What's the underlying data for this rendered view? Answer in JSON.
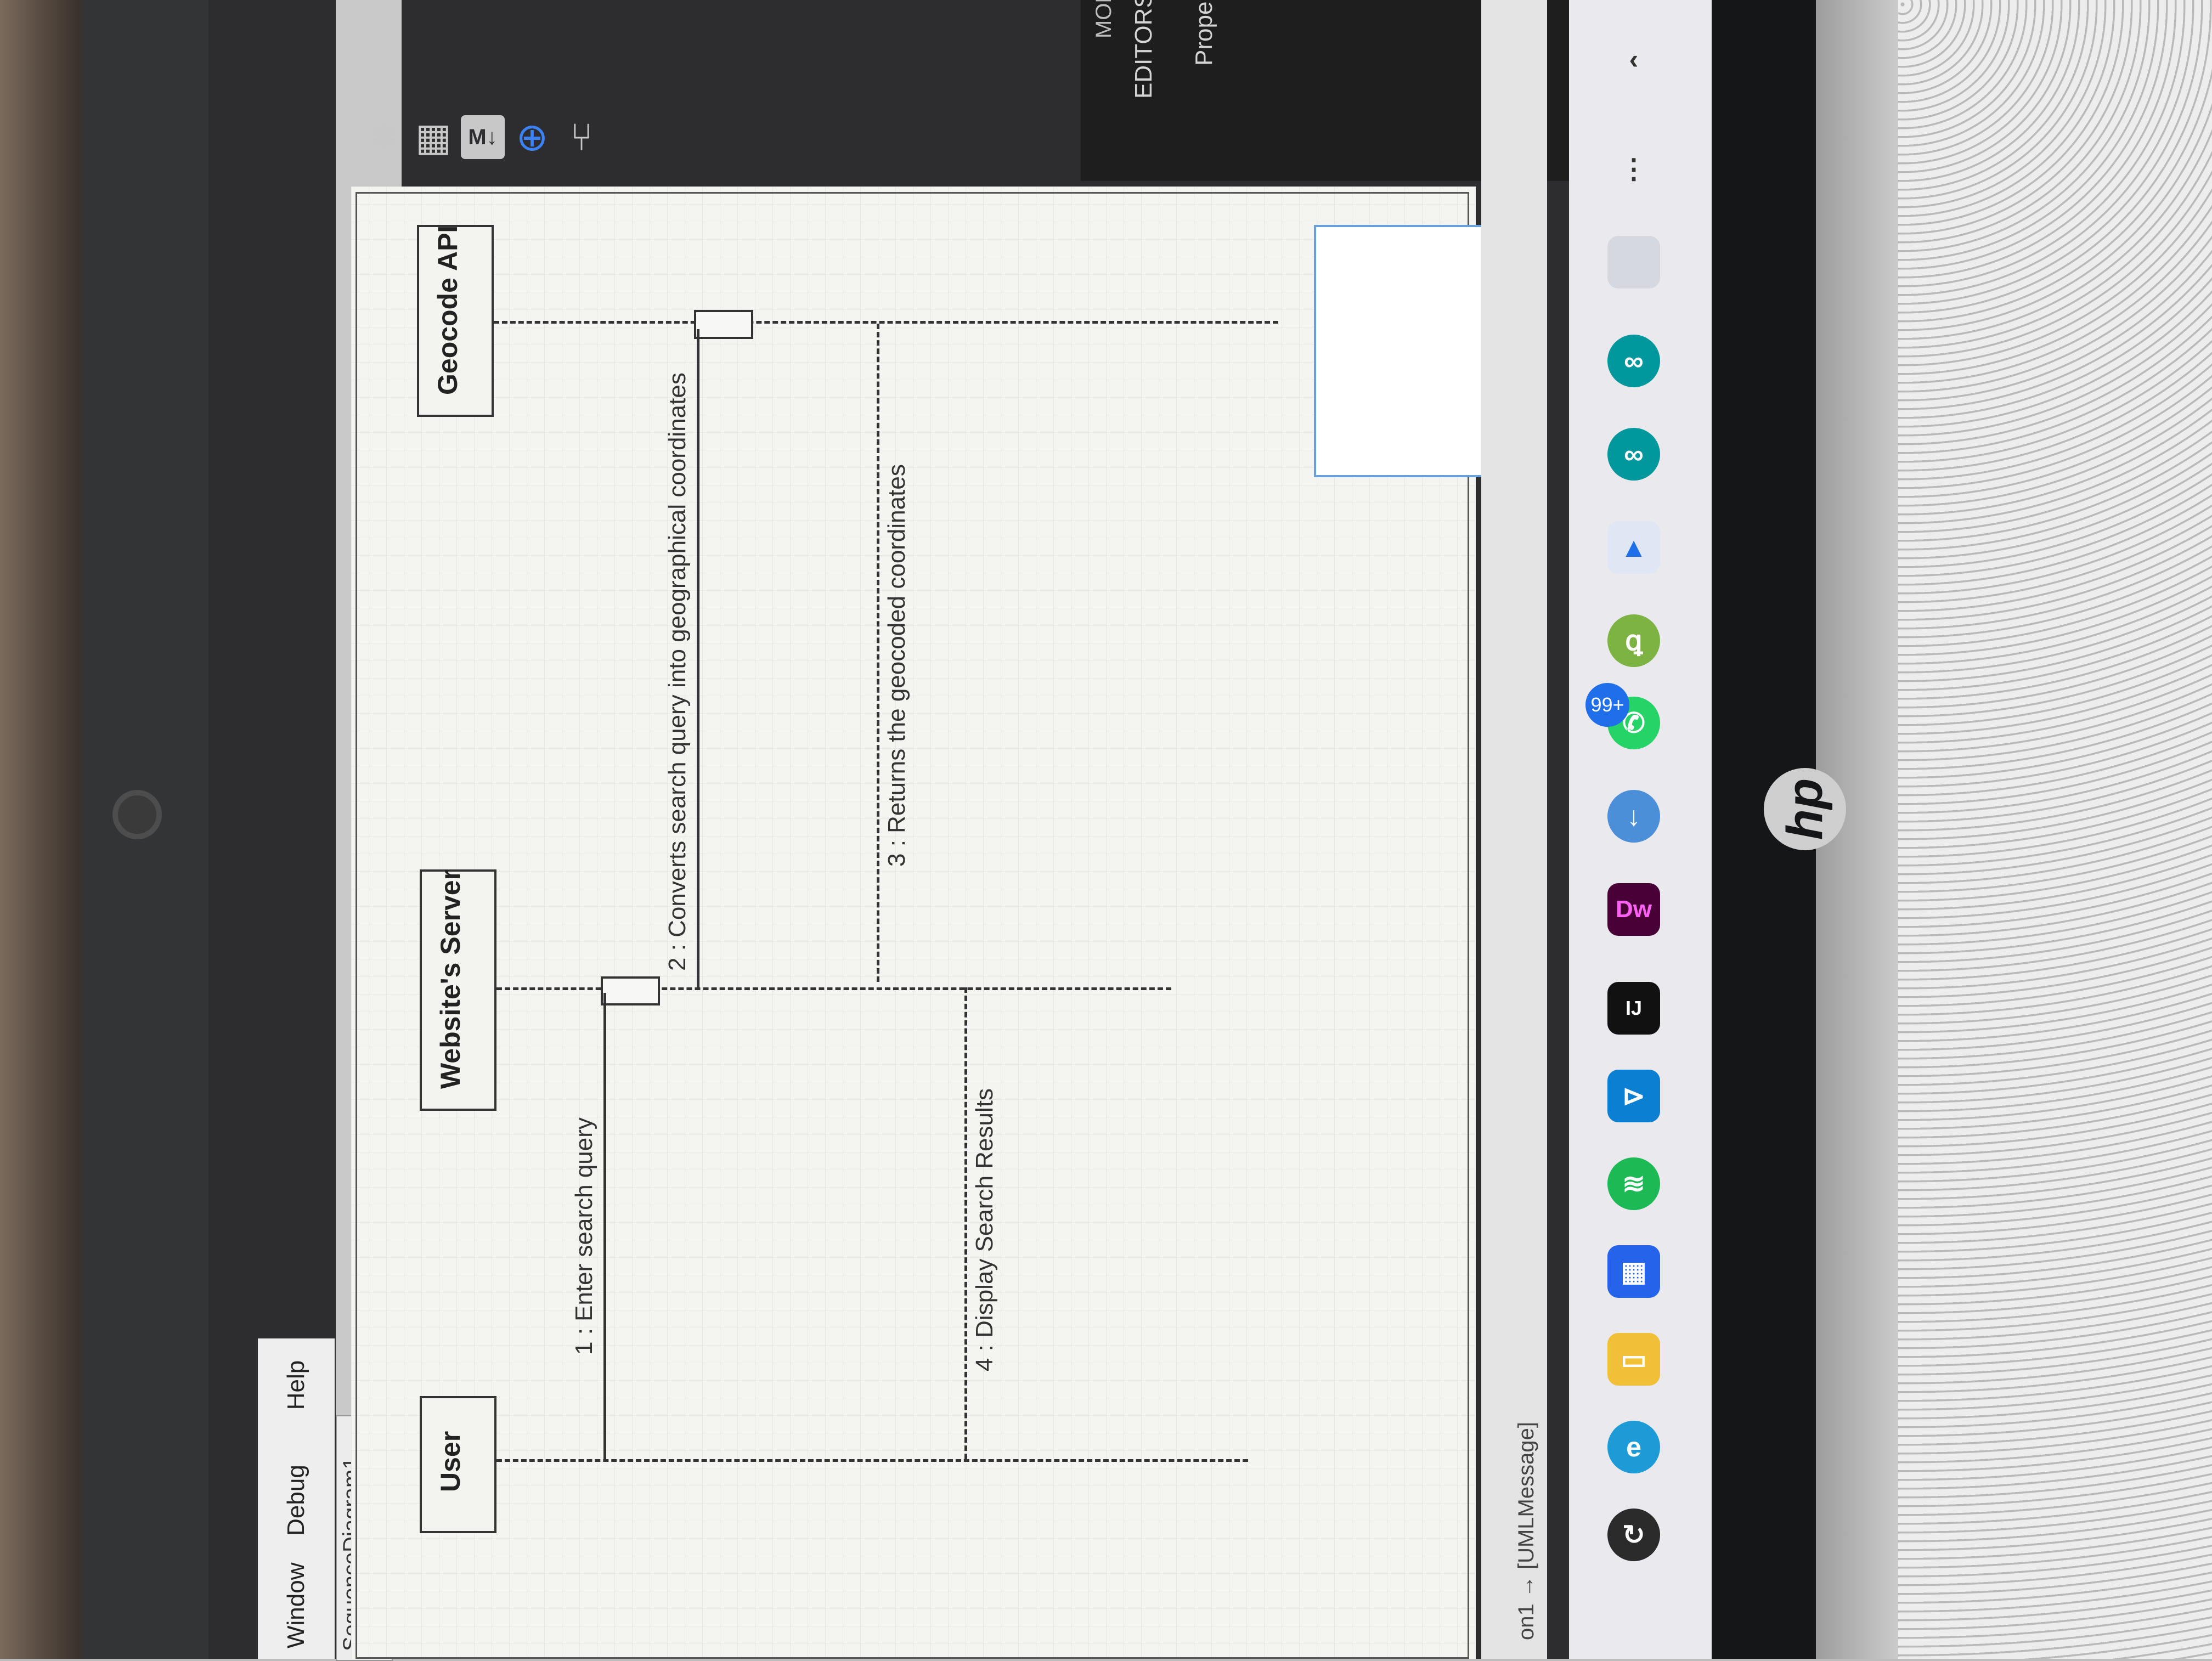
{
  "menu": {
    "items": [
      "Window",
      "Debug",
      "Help"
    ]
  },
  "diagram": {
    "tab_title": "SequenceDiagram1",
    "lifelines": [
      "User",
      "Website's Server",
      "Geocode API"
    ],
    "messages": [
      {
        "label": "1 : Enter search query",
        "from": "User",
        "to": "Website's Server",
        "style": "solid"
      },
      {
        "label": "2 : Converts search query into geographical coordinates",
        "from": "Website's Server",
        "to": "Geocode API",
        "style": "solid"
      },
      {
        "label": "3 : Returns the geocoded coordinates",
        "from": "Geocode API",
        "to": "Website's Server",
        "style": "dashed"
      },
      {
        "label": "4 : Display Search Results",
        "from": "Website's Server",
        "to": "User",
        "style": "dashed"
      }
    ]
  },
  "toolbar": {
    "icons": [
      "extension-icon",
      "layout-icon",
      "markdown-icon",
      "crosshair-icon",
      "git-branch-icon"
    ],
    "markdown_label": "M↓"
  },
  "right_panel": {
    "editors_label": "EDITORS",
    "properties_label": "Prope",
    "model_label": "MODEL"
  },
  "status": {
    "text": "on1  →  [UMLMessage]"
  },
  "taskbar": {
    "badge": "99+",
    "dw_label": "Dw",
    "ij_label": "IJ"
  },
  "colors": {
    "accent": "#1f6feb",
    "canvas": "#f4f4f1",
    "dark_ui": "#1e1e1e"
  }
}
